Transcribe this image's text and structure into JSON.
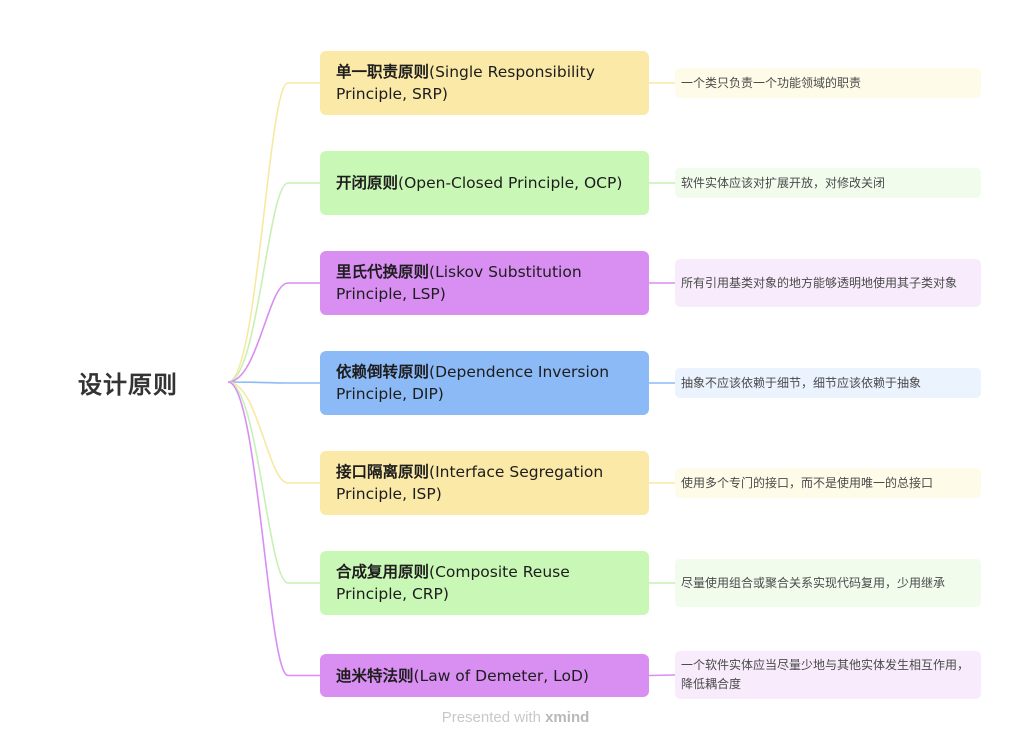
{
  "root": {
    "title": "设计原则"
  },
  "branches": [
    {
      "id": "srp",
      "title_cn": "单一职责原则",
      "title_en": "(Single Responsibility Principle, SRP)",
      "description": "一个类只负责一个功能领域的职责",
      "color": "#fbe9a8",
      "desc_bg": "#fffbe9",
      "line_color": "#f7e9a0"
    },
    {
      "id": "ocp",
      "title_cn": "开闭原则",
      "title_en": "(Open-Closed Principle, OCP)",
      "description": "软件实体应该对扩展开放，对修改关闭",
      "color": "#c9f7b6",
      "desc_bg": "#f1fced",
      "line_color": "#c6f0b5"
    },
    {
      "id": "lsp",
      "title_cn": "里氏代换原则",
      "title_en": "(Liskov Substitution Principle, LSP)",
      "description": "所有引用基类对象的地方能够透明地使用其子类对象",
      "color": "#d98ef2",
      "desc_bg": "#f8ecfc",
      "line_color": "#d98ef2"
    },
    {
      "id": "dip",
      "title_cn": "依赖倒转原则",
      "title_en": "(Dependence Inversion Principle, DIP)",
      "description": "抽象不应该依赖于细节，细节应该依赖于抽象",
      "color": "#8cbaf7",
      "desc_bg": "#ebf3fe",
      "line_color": "#8cbaf7"
    },
    {
      "id": "isp",
      "title_cn": "接口隔离原则",
      "title_en": "(Interface Segregation Principle, ISP)",
      "description": "使用多个专门的接口，而不是使用唯一的总接口",
      "color": "#fbe9a8",
      "desc_bg": "#fffbe9",
      "line_color": "#f7e9a0"
    },
    {
      "id": "crp",
      "title_cn": "合成复用原则",
      "title_en": "(Composite Reuse Principle, CRP)",
      "description": "尽量使用组合或聚合关系实现代码复用，少用继承",
      "color": "#c9f7b6",
      "desc_bg": "#f1fced",
      "line_color": "#c6f0b5"
    },
    {
      "id": "lod",
      "title_cn": "迪米特法则",
      "title_en": "(Law of Demeter, LoD)",
      "description": "一个软件实体应当尽量少地与其他实体发生相互作用，降低耦合度",
      "color": "#d98ef2",
      "desc_bg": "#f8ecfc",
      "line_color": "#d98ef2"
    }
  ],
  "footer": {
    "prefix": "Presented with ",
    "brand": "xmind"
  }
}
